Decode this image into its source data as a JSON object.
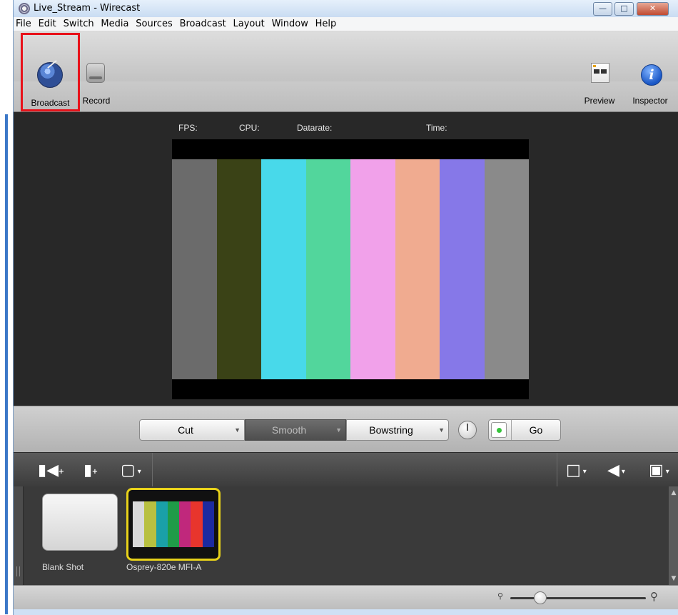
{
  "window": {
    "title": "Live_Stream - Wirecast"
  },
  "menu": [
    "File",
    "Edit",
    "Switch",
    "Media",
    "Sources",
    "Broadcast",
    "Layout",
    "Window",
    "Help"
  ],
  "toolbar": {
    "broadcast_label": "Broadcast",
    "record_label": "Record",
    "preview_label": "Preview",
    "inspector_label": "Inspector",
    "highlight_color": "#e8121a"
  },
  "stats": {
    "fps": "FPS:",
    "cpu": "CPU:",
    "datarate": "Datarate:",
    "time": "Time:"
  },
  "color_bars": [
    "#6b6b6b",
    "#3a4216",
    "#48d9ea",
    "#52d69c",
    "#f1a1ea",
    "#f0ab90",
    "#8678e8",
    "#8a8a8a"
  ],
  "transitions": {
    "cut": "Cut",
    "smooth": "Smooth",
    "bowstring": "Bowstring",
    "go": "Go"
  },
  "shots": [
    {
      "label": "Blank Shot"
    },
    {
      "label": "Osprey-820e MFI-A",
      "selected_color": "#e8d21a"
    }
  ],
  "osprey_bars": [
    "#d9d9d9",
    "#b8c040",
    "#1aa0a8",
    "#1f9c48",
    "#c0287c",
    "#e8352c",
    "#1c2aa0"
  ],
  "zoom": {
    "level": 0.22
  }
}
